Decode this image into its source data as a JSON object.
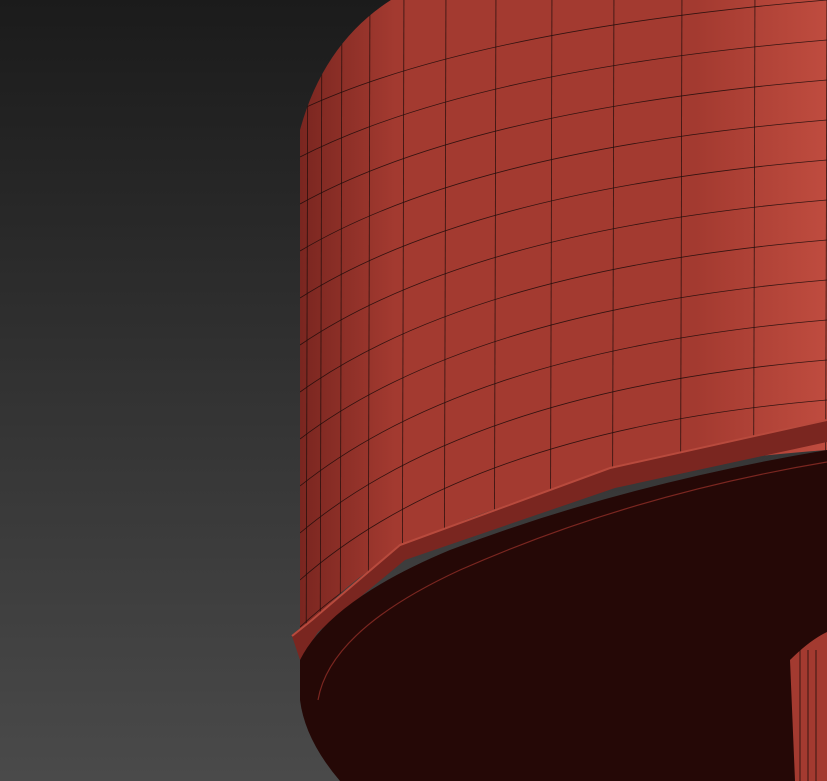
{
  "viewport": {
    "background_top": "#1b1b1b",
    "background_bottom": "#4a4a4a"
  },
  "model": {
    "base_color": "#a33a30",
    "highlight_color": "#bf4c3f",
    "shade_color": "#7a2620",
    "wire_color": "#1e0c0a",
    "underside_color": "#250806",
    "rim_color": "#b84a3d"
  }
}
